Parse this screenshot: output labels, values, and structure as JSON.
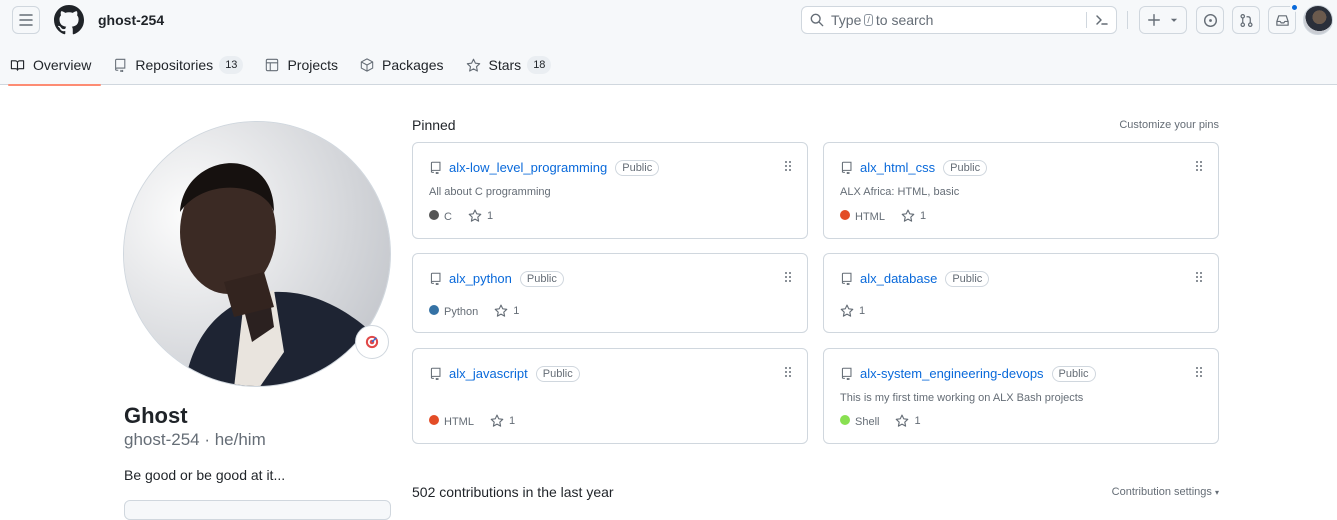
{
  "header": {
    "username": "ghost-254",
    "search": {
      "prefix": "Type",
      "key": "/",
      "suffix": "to search"
    },
    "icons": [
      "menu-icon",
      "github-logo",
      "search-icon",
      "command-palette-icon",
      "plus-icon",
      "issues-icon",
      "pull-requests-icon",
      "inbox-icon"
    ]
  },
  "tabs": [
    {
      "label": "Overview",
      "selected": true
    },
    {
      "label": "Repositories",
      "count": "13"
    },
    {
      "label": "Projects"
    },
    {
      "label": "Packages"
    },
    {
      "label": "Stars",
      "count": "18"
    }
  ],
  "profile": {
    "name": "Ghost",
    "login": "ghost-254 · he/him",
    "bio": "Be good or be good at it..."
  },
  "pinned": {
    "title": "Pinned",
    "customize": "Customize your pins",
    "visibility": "Public",
    "repos": [
      {
        "name": "alx-low_level_programming",
        "desc": "All about C programming",
        "lang": "C",
        "lang_color": "#555555",
        "stars": "1"
      },
      {
        "name": "alx_html_css",
        "desc": "ALX Africa: HTML, basic",
        "lang": "HTML",
        "lang_color": "#e34c26",
        "stars": "1"
      },
      {
        "name": "alx_python",
        "desc": "",
        "lang": "Python",
        "lang_color": "#3572A5",
        "stars": "1"
      },
      {
        "name": "alx_database",
        "desc": "",
        "lang": "",
        "lang_color": "",
        "stars": "1"
      },
      {
        "name": "alx_javascript",
        "desc": "",
        "lang": "HTML",
        "lang_color": "#e34c26",
        "stars": "1"
      },
      {
        "name": "alx-system_engineering-devops",
        "desc": "This is my first time working on ALX Bash projects",
        "lang": "Shell",
        "lang_color": "#89e051",
        "stars": "1"
      }
    ]
  },
  "contributions": {
    "title": "502 contributions in the last year",
    "settings": "Contribution settings"
  }
}
